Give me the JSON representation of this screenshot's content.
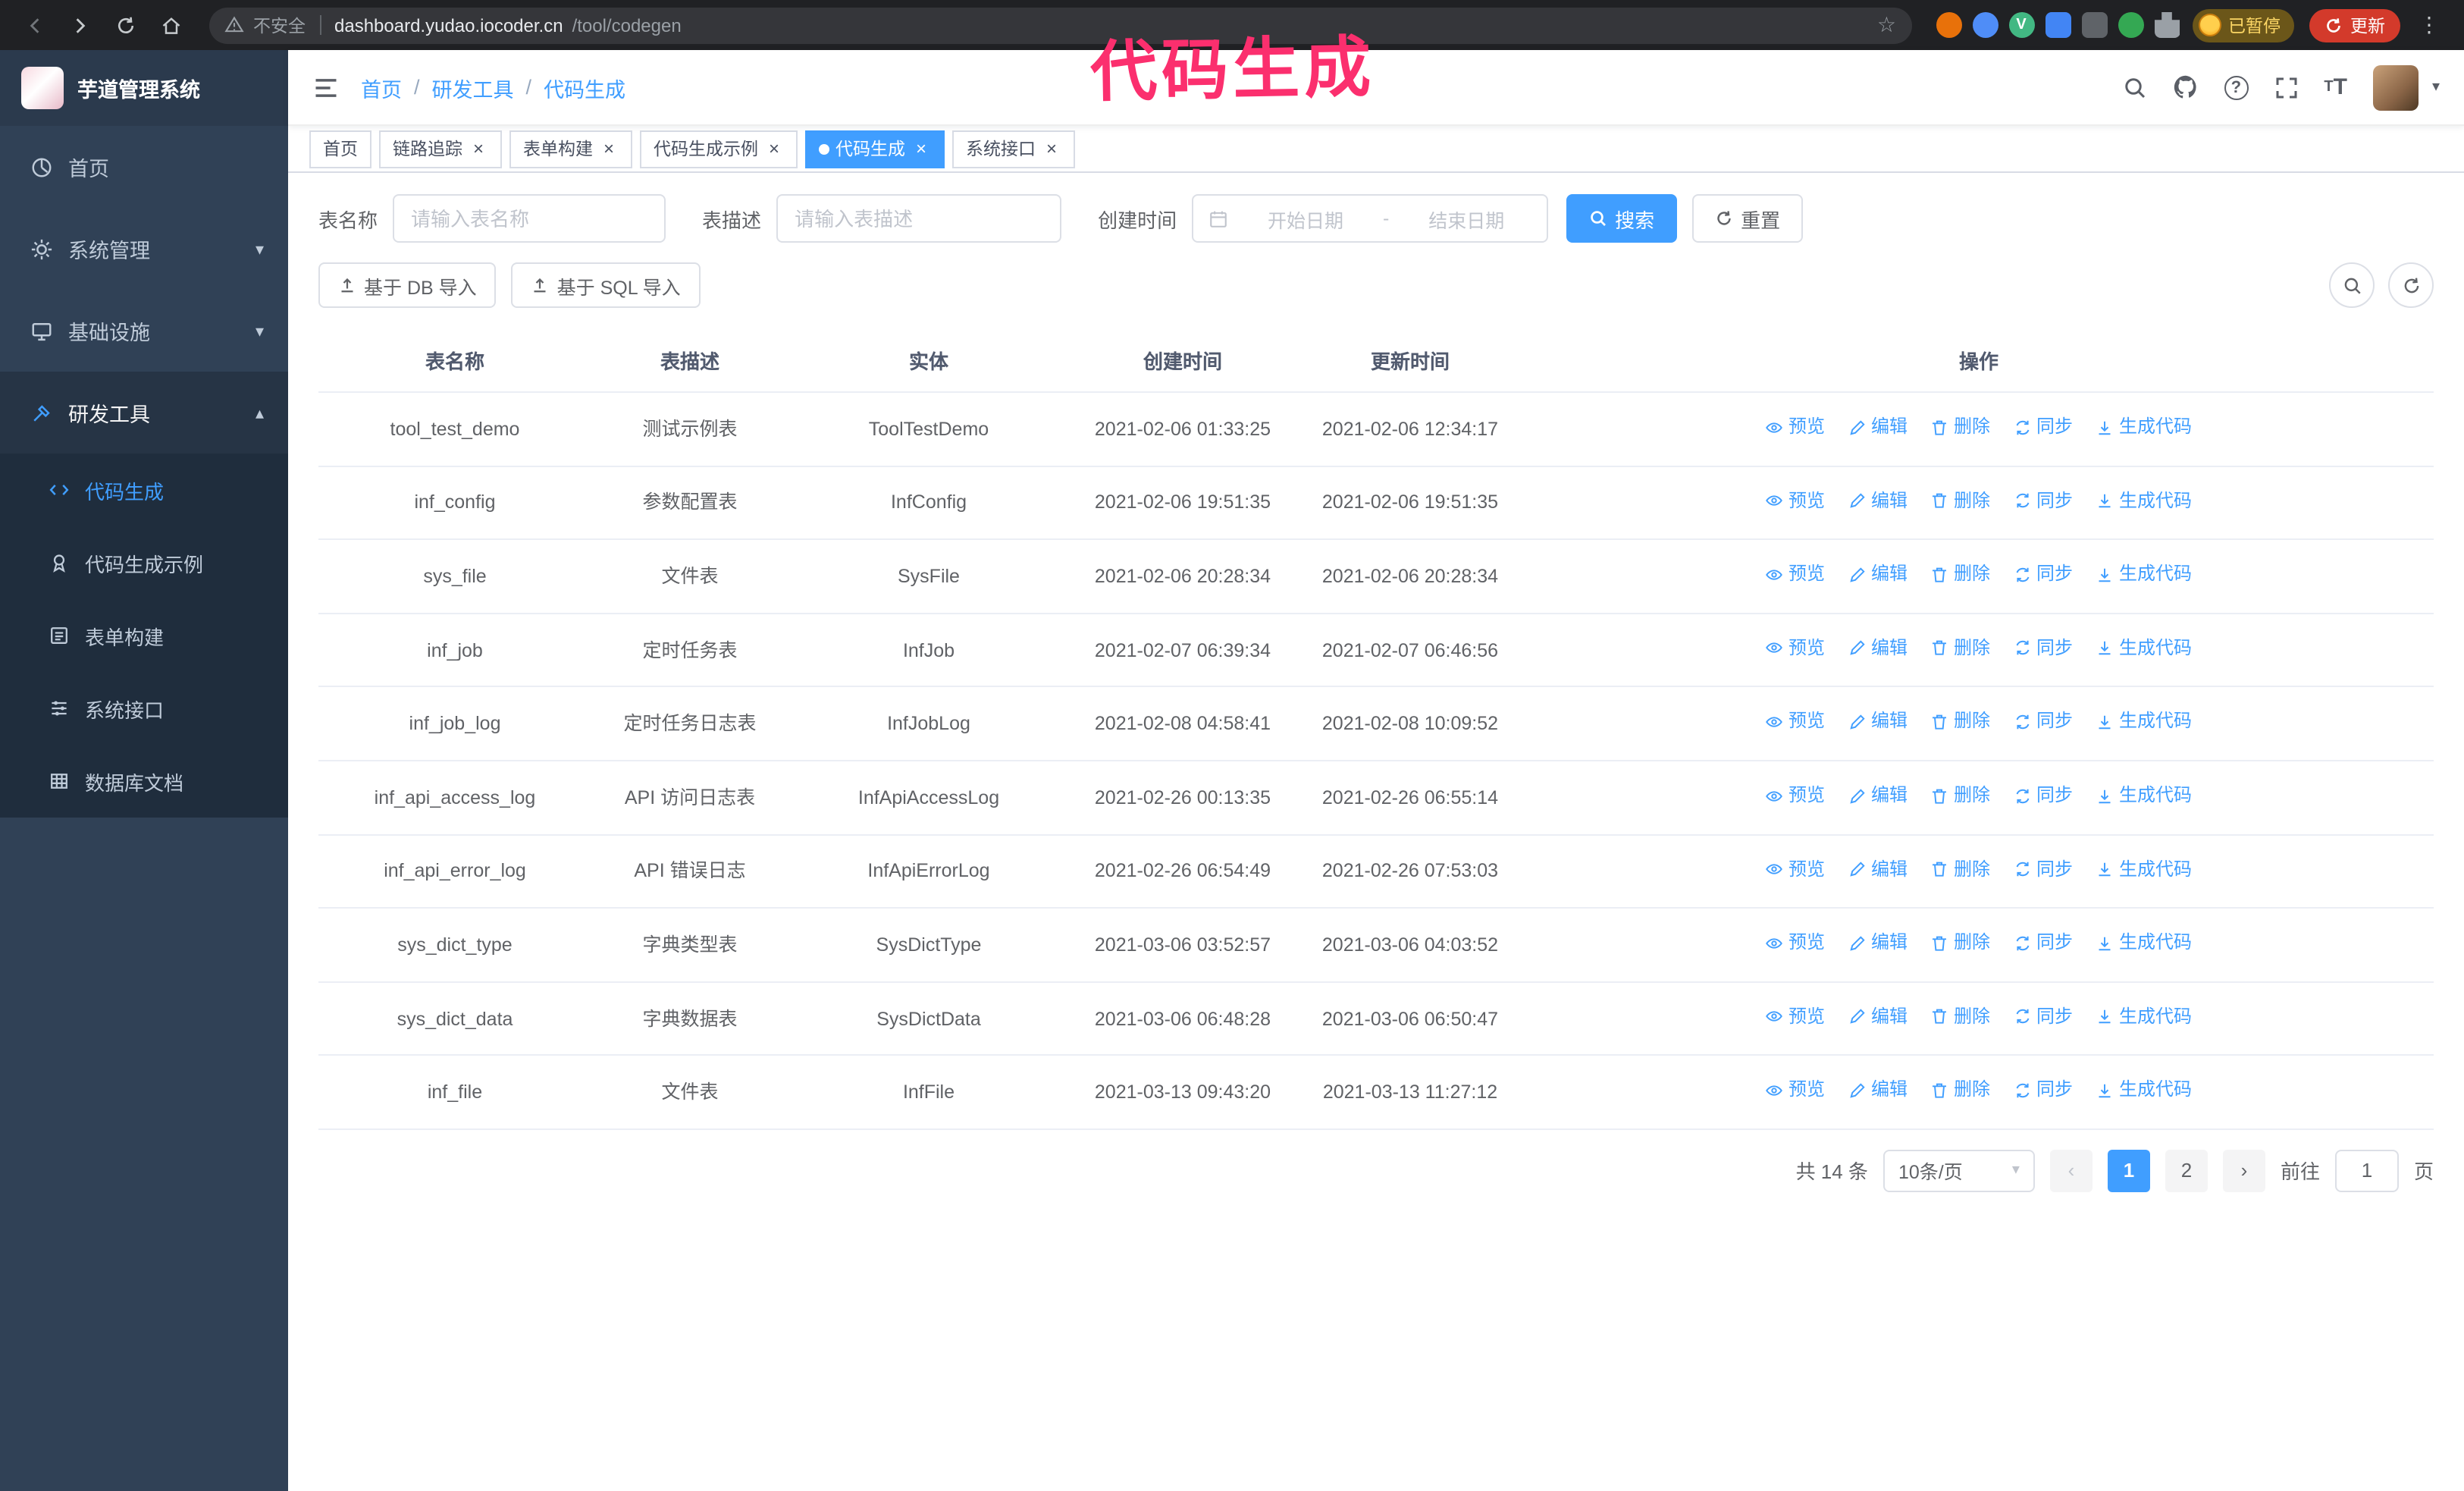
{
  "annotation": {
    "text": "代码生成"
  },
  "colors": {
    "accent": "#409eff",
    "sidebar_bg": "#304156",
    "submenu_bg": "#1f2d3d",
    "tag_active_bg": "#409eff",
    "annotation_pink": "#fb2f6e",
    "update_button_red": "#d33a2b"
  },
  "browser": {
    "security_label": "不安全",
    "url_host": "dashboard.yudao.iocoder.cn",
    "url_path": "/tool/codegen",
    "paused_badge": "已暂停",
    "update_label": "更新"
  },
  "sidebar": {
    "app_title": "芋道管理系统",
    "items": [
      {
        "label": "首页"
      },
      {
        "label": "系统管理"
      },
      {
        "label": "基础设施"
      },
      {
        "label": "研发工具"
      }
    ],
    "subitems": [
      {
        "label": "代码生成"
      },
      {
        "label": "代码生成示例"
      },
      {
        "label": "表单构建"
      },
      {
        "label": "系统接口"
      },
      {
        "label": "数据库文档"
      }
    ]
  },
  "header": {
    "breadcrumb": [
      "首页",
      "研发工具",
      "代码生成"
    ],
    "separator": "/"
  },
  "tabs": [
    {
      "label": "首页"
    },
    {
      "label": "链路追踪"
    },
    {
      "label": "表单构建"
    },
    {
      "label": "代码生成示例"
    },
    {
      "label": "代码生成"
    },
    {
      "label": "系统接口"
    }
  ],
  "filters": {
    "table_name_label": "表名称",
    "table_name_placeholder": "请输入表名称",
    "table_desc_label": "表描述",
    "table_desc_placeholder": "请输入表描述",
    "create_time_label": "创建时间",
    "start_date_placeholder": "开始日期",
    "range_separator": "-",
    "end_date_placeholder": "结束日期",
    "search_label": "搜索",
    "reset_label": "重置"
  },
  "toolbar": {
    "import_db": "基于 DB 导入",
    "import_sql": "基于 SQL 导入"
  },
  "table": {
    "columns": [
      "表名称",
      "表描述",
      "实体",
      "创建时间",
      "更新时间",
      "操作"
    ],
    "actions": [
      "预览",
      "编辑",
      "删除",
      "同步",
      "生成代码"
    ],
    "rows": [
      {
        "name": "tool_test_demo",
        "desc": "测试示例表",
        "entity": "ToolTestDemo",
        "created": "2021-02-06 01:33:25",
        "updated": "2021-02-06 12:34:17"
      },
      {
        "name": "inf_config",
        "desc": "参数配置表",
        "entity": "InfConfig",
        "created": "2021-02-06 19:51:35",
        "updated": "2021-02-06 19:51:35"
      },
      {
        "name": "sys_file",
        "desc": "文件表",
        "entity": "SysFile",
        "created": "2021-02-06 20:28:34",
        "updated": "2021-02-06 20:28:34"
      },
      {
        "name": "inf_job",
        "desc": "定时任务表",
        "entity": "InfJob",
        "created": "2021-02-07 06:39:34",
        "updated": "2021-02-07 06:46:56"
      },
      {
        "name": "inf_job_log",
        "desc": "定时任务日志表",
        "entity": "InfJobLog",
        "created": "2021-02-08 04:58:41",
        "updated": "2021-02-08 10:09:52"
      },
      {
        "name": "inf_api_access_log",
        "desc": "API 访问日志表",
        "entity": "InfApiAccessLog",
        "created": "2021-02-26 00:13:35",
        "updated": "2021-02-26 06:55:14"
      },
      {
        "name": "inf_api_error_log",
        "desc": "API 错误日志",
        "entity": "InfApiErrorLog",
        "created": "2021-02-26 06:54:49",
        "updated": "2021-02-26 07:53:03"
      },
      {
        "name": "sys_dict_type",
        "desc": "字典类型表",
        "entity": "SysDictType",
        "created": "2021-03-06 03:52:57",
        "updated": "2021-03-06 04:03:52"
      },
      {
        "name": "sys_dict_data",
        "desc": "字典数据表",
        "entity": "SysDictData",
        "created": "2021-03-06 06:48:28",
        "updated": "2021-03-06 06:50:47"
      },
      {
        "name": "inf_file",
        "desc": "文件表",
        "entity": "InfFile",
        "created": "2021-03-13 09:43:20",
        "updated": "2021-03-13 11:27:12"
      }
    ]
  },
  "pagination": {
    "total": "共 14 条",
    "page_size": "10条/页",
    "page1": "1",
    "page2": "2",
    "goto_label": "前往",
    "goto_value": "1",
    "page_unit": "页"
  }
}
